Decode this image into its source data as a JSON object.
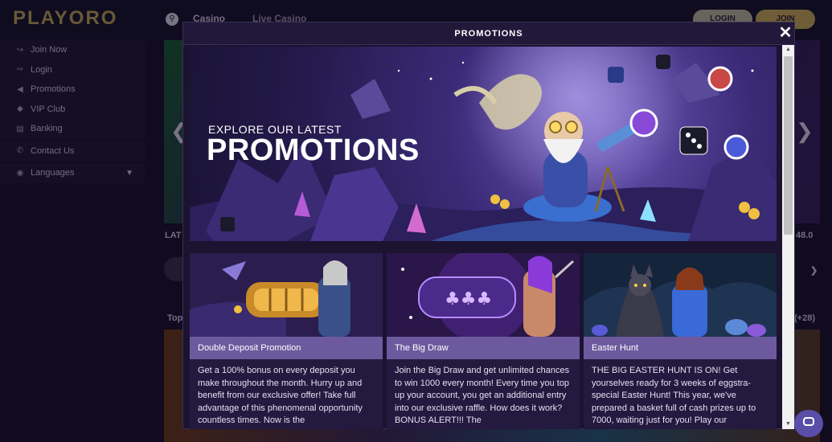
{
  "header": {
    "logo": "PLAYORO",
    "nav_tabs": [
      "Casino",
      "Live Casino"
    ],
    "login_label": "LOGIN",
    "join_label": "JOIN"
  },
  "sidebar": {
    "items": [
      {
        "label": "Join Now",
        "icon": "login-arrow-icon"
      },
      {
        "label": "Login",
        "icon": "login-icon"
      },
      {
        "label": "Promotions",
        "icon": "megaphone-icon"
      },
      {
        "label": "VIP Club",
        "icon": "diamond-icon"
      },
      {
        "label": "Banking",
        "icon": "bank-icon"
      },
      {
        "label": "Contact Us",
        "icon": "phone-icon"
      },
      {
        "label": "Languages",
        "icon": "globe-icon"
      }
    ]
  },
  "background": {
    "latest_label": "LAT",
    "amount": "48.0",
    "top_label": "Top",
    "more_count": "(+28)"
  },
  "modal": {
    "title": "PROMOTIONS",
    "banner_sub": "EXPLORE OUR LATEST",
    "banner_title": "PROMOTIONS",
    "cards": [
      {
        "title": "Double Deposit Promotion",
        "desc": "Get a 100% bonus on every deposit you make throughout the month. Hurry up and benefit from our exclusive offer! Take full advantage of this phenomenal opportunity countless times. Now is the"
      },
      {
        "title": "The Big Draw",
        "desc": "Join the Big Draw and get unlimited chances to win 1000 every month! Every time you top up your account, you get an additional entry into our exclusive raffle. How does it work? BONUS ALERT!!! The"
      },
      {
        "title": "Easter Hunt",
        "desc": "THE BIG EASTER HUNT IS ON! Get yourselves ready for 3 weeks of eggstra-special Easter Hunt! This year, we've prepared a basket full of cash prizes up to 7000, waiting just for you!  Play our"
      }
    ]
  },
  "colors": {
    "accent_gold": "#c6a85c",
    "card_title_bg": "#6d5a9e",
    "modal_bg": "#1b1330"
  }
}
